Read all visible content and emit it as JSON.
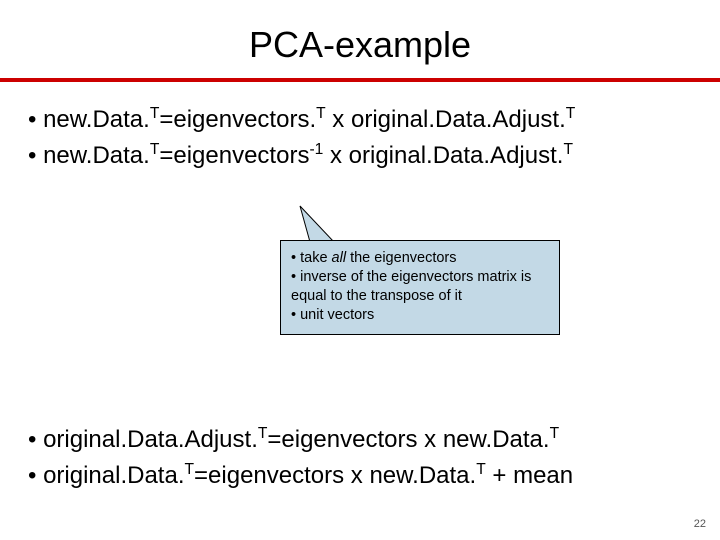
{
  "title": "PCA-example",
  "eq1": {
    "lhs": "new.Data.",
    "lhs_sup": "T",
    "eq": "=eigenvectors.",
    "mid_sup": "T",
    "rhs": " x original.Data.Adjust.",
    "rhs_sup": "T"
  },
  "eq2": {
    "lhs": "new.Data.",
    "lhs_sup": "T",
    "eq": "=eigenvectors",
    "mid_sup": "-1",
    "rhs": " x original.Data.Adjust.",
    "rhs_sup": "T"
  },
  "callout": {
    "l1_pre": "• take ",
    "l1_ital": "all",
    "l1_post": " the eigenvectors",
    "l2": "• inverse of the eigenvectors matrix is equal to the transpose of it",
    "l3": "• unit vectors"
  },
  "eq3": {
    "lhs": "original.Data.Adjust.",
    "lhs_sup": "T",
    "eq": "=eigenvectors x new.Data.",
    "rhs_sup": "T"
  },
  "eq4": {
    "lhs": "original.Data.",
    "lhs_sup": "T",
    "eq": "=eigenvectors x new.Data.",
    "rhs_sup": "T",
    "tail": " + mean"
  },
  "page_number": "22"
}
